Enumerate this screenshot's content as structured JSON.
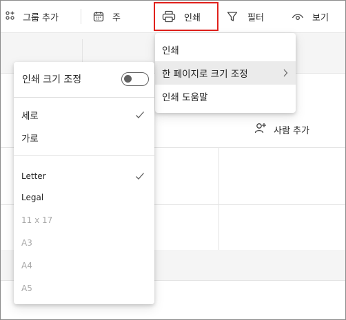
{
  "toolbar": {
    "group_add_label": "그룹 추가",
    "week_label": "주",
    "print_label": "인쇄",
    "filter_label": "필터",
    "view_label": "보기"
  },
  "print_menu": {
    "items": [
      {
        "label": "인쇄"
      },
      {
        "label": "한 페이지로 크기 조정",
        "has_submenu": true,
        "highlighted": true
      },
      {
        "label": "인쇄 도움말"
      }
    ]
  },
  "scale_panel": {
    "title": "인쇄 크기 조정",
    "toggle_on": false,
    "orientations": [
      {
        "label": "세로",
        "checked": true
      },
      {
        "label": "가로",
        "checked": false
      }
    ],
    "paper_sizes": [
      {
        "label": "Letter",
        "checked": true,
        "enabled": true
      },
      {
        "label": "Legal",
        "checked": false,
        "enabled": true
      },
      {
        "label": "11 x 17",
        "checked": false,
        "enabled": false
      },
      {
        "label": "A3",
        "checked": false,
        "enabled": false
      },
      {
        "label": "A4",
        "checked": false,
        "enabled": false
      },
      {
        "label": "A5",
        "checked": false,
        "enabled": false
      }
    ]
  },
  "page": {
    "add_person_label": "사람 추가"
  },
  "colors": {
    "highlight_border": "#e0201b",
    "disabled_text": "#a8a8a8"
  }
}
